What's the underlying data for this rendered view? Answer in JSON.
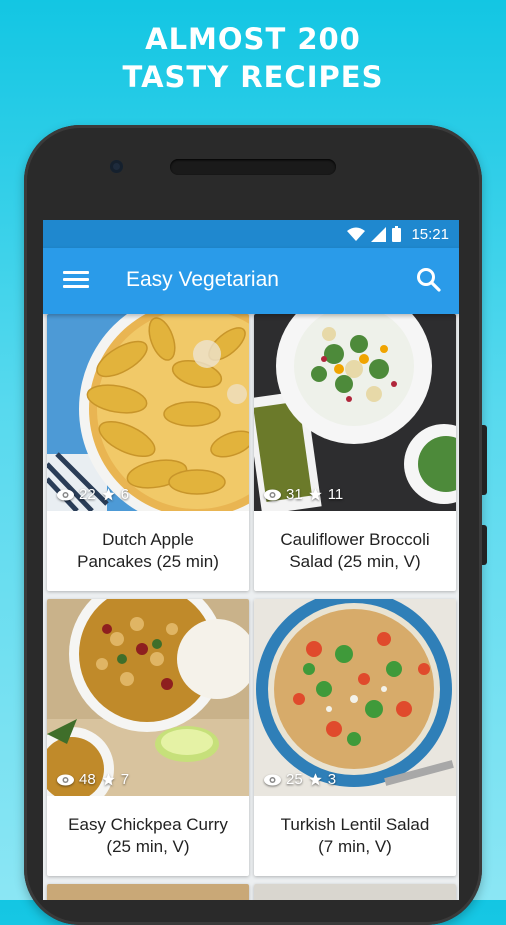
{
  "promo": {
    "line1": "ALMOST 200",
    "line2": "TASTY RECIPES"
  },
  "status_bar": {
    "time": "15:21",
    "icons": [
      "wifi-icon",
      "signal-icon",
      "battery-icon"
    ]
  },
  "app_bar": {
    "title": "Easy Vegetarian",
    "menu_icon": "hamburger-menu-icon",
    "search_icon": "search-icon"
  },
  "recipes": [
    {
      "title_line1": "Dutch Apple",
      "title_line2": "Pancakes (25 min)",
      "views": "22",
      "stars": "6"
    },
    {
      "title_line1": "Cauliflower Broccoli",
      "title_line2": "Salad (25 min, V)",
      "views": "31",
      "stars": "11"
    },
    {
      "title_line1": "Easy Chickpea Curry",
      "title_line2": "(25 min, V)",
      "views": "48",
      "stars": "7"
    },
    {
      "title_line1": "Turkish Lentil Salad",
      "title_line2": "(7 min, V)",
      "views": "25",
      "stars": "3"
    }
  ],
  "colors": {
    "status_bar": "#1f88cf",
    "app_bar": "#2a9be9",
    "background_top": "#13c6e3"
  }
}
